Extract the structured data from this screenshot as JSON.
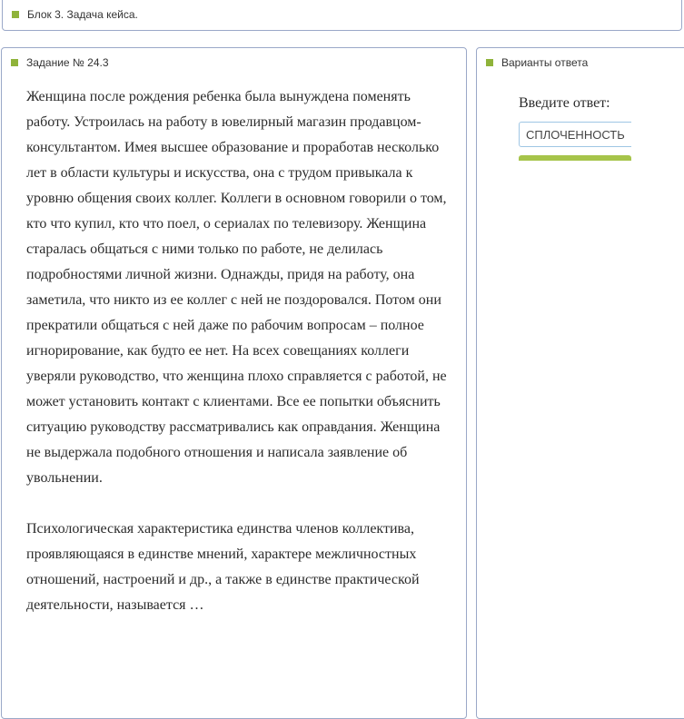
{
  "block_panel": {
    "title": "Блок 3. Задача кейса."
  },
  "task_panel": {
    "title": "Задание № 24.3",
    "paragraphs": [
      "Женщина после рождения ребенка была вынуждена поменять работу. Устроилась на работу в ювелирный магазин продавцом-консультантом. Имея высшее образование и проработав несколько лет в области культуры и искусства, она с трудом привыкала к уровню общения своих коллег. Коллеги в основном говорили о том, кто что купил, кто что поел, о сериалах по телевизору. Женщина старалась общаться с ними только по работе, не делилась подробностями личной жизни. Однажды, придя на работу, она заметила, что никто из ее коллег с ней не поздоровался. Потом они прекратили общаться с ней даже по рабочим вопросам – полное игнорирование, как будто ее нет. На всех совещаниях коллеги уверяли руководство, что женщина плохо справляется с работой, не может установить контакт с клиентами. Все ее попытки объяснить ситуацию руководству рассматривались как оправдания. Женщина не выдержала подобного отношения и написала заявление об увольнении.",
      "Психологическая характеристика единства членов коллектива, проявляющаяся в единстве мнений, характере межличностных отношений, настроений и др., а также в единстве практической деятельности, называется …"
    ]
  },
  "answer_panel": {
    "title": "Варианты ответа",
    "prompt_label": "Введите ответ:",
    "input_value": "СПЛОЧЕННОСТЬ"
  },
  "colors": {
    "accent_bullet": "#8fb33a",
    "panel_border": "#9aa8c8",
    "input_border": "#9fc6e4",
    "button_green": "#a6c44a"
  }
}
